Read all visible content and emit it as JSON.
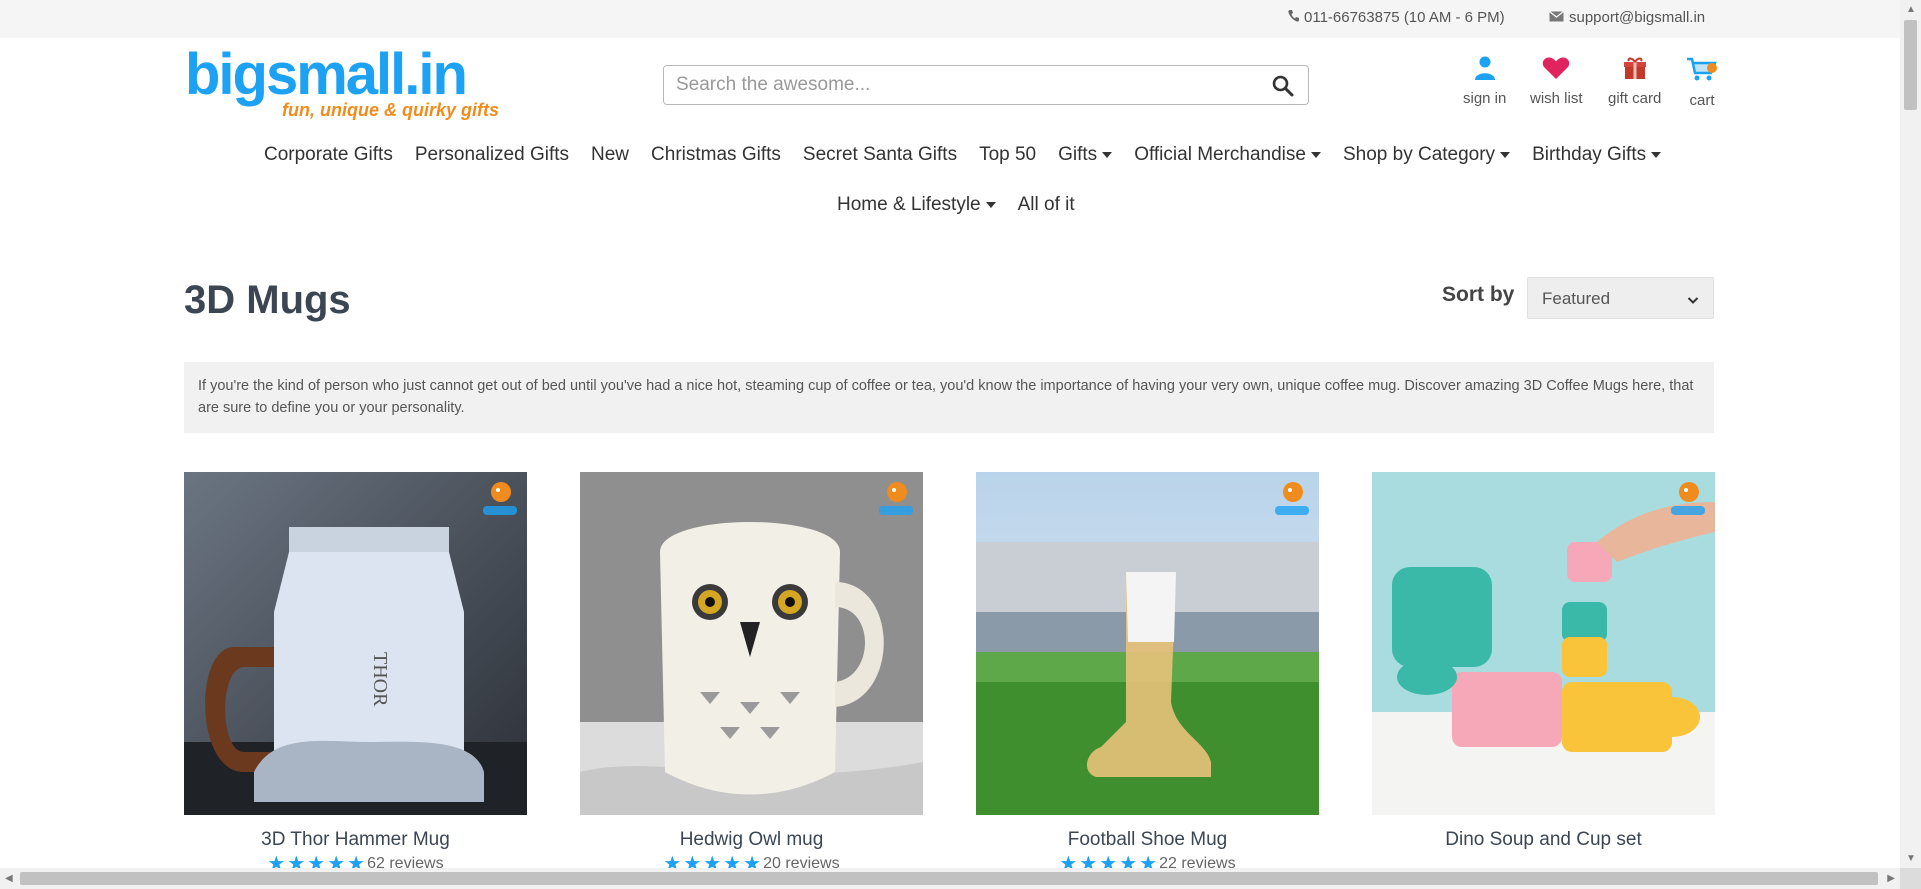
{
  "topbar": {
    "phone": "011-66763875 (10 AM - 6 PM)",
    "email": "support@bigsmall.in",
    "phone_icon": "phone-icon",
    "email_icon": "envelope-icon"
  },
  "brand": {
    "name": "bigsmall.in",
    "tagline": "fun, unique & quirky gifts",
    "color": "#1da1f2",
    "tagline_color": "#f08c1e"
  },
  "search": {
    "placeholder": "Search the awesome...",
    "value": "",
    "icon": "search-icon"
  },
  "user_nav": [
    {
      "label": "sign in",
      "icon": "user-icon",
      "color": "#1da1f2"
    },
    {
      "label": "wish list",
      "icon": "heart-icon",
      "color": "#e0245e"
    },
    {
      "label": "gift card",
      "icon": "gift-icon",
      "color": "#c0392b"
    },
    {
      "label": "cart",
      "icon": "cart-icon",
      "color": "#1da1f2"
    }
  ],
  "main_nav": {
    "row1": [
      {
        "label": "Corporate Gifts"
      },
      {
        "label": "Personalized Gifts"
      },
      {
        "label": "New"
      },
      {
        "label": "Christmas Gifts"
      },
      {
        "label": "Secret Santa Gifts"
      },
      {
        "label": "Top 50"
      },
      {
        "label": "Gifts",
        "dropdown": true
      },
      {
        "label": "Official Merchandise",
        "dropdown": true
      },
      {
        "label": "Shop by Category",
        "dropdown": true
      },
      {
        "label": "Birthday Gifts",
        "dropdown": true
      }
    ],
    "row2": [
      {
        "label": "Home & Lifestyle",
        "dropdown": true
      },
      {
        "label": "All of it"
      }
    ]
  },
  "page": {
    "title": "3D Mugs",
    "sort_label": "Sort by",
    "sort_value": "Featured",
    "description": "If you're the kind of person who just cannot get out of bed until you've had a nice hot, steaming cup of coffee or tea, you'd know the importance of having your very own, unique coffee mug. Discover amazing 3D Coffee Mugs here, that are sure to define you or your personality."
  },
  "products": [
    {
      "name": "3D Thor Hammer Mug",
      "stars": 5,
      "reviews": "62 reviews"
    },
    {
      "name": "Hedwig Owl mug",
      "stars": 5,
      "reviews": "20 reviews"
    },
    {
      "name": "Football Shoe Mug",
      "stars": 5,
      "reviews": "22 reviews"
    },
    {
      "name": "Dino Soup and Cup set",
      "stars": 0,
      "reviews": ""
    }
  ],
  "product_image_text": {
    "thor_mug": "THOR"
  }
}
